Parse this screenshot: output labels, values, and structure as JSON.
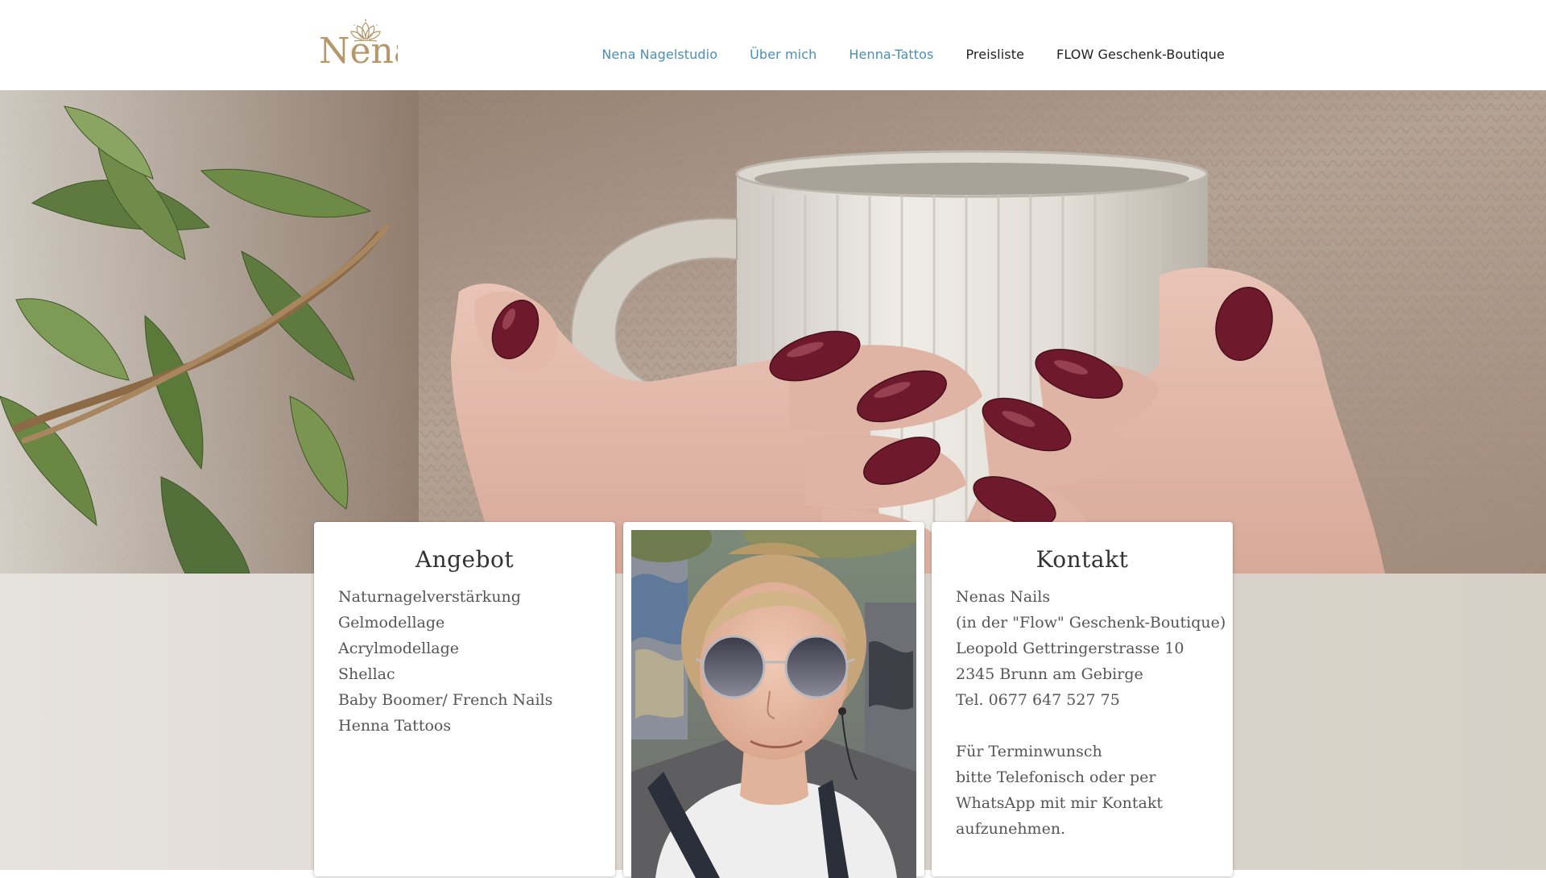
{
  "header": {
    "logo_text": "Nena",
    "nav": [
      {
        "label": "Nena Nagelstudio",
        "color": "#4b8fb5"
      },
      {
        "label": "Über mich",
        "color": "#4b8fb5"
      },
      {
        "label": "Henna-Tattos",
        "color": "#4b8fb5"
      },
      {
        "label": "Preisliste",
        "color": "#222222"
      },
      {
        "label": "FLOW Geschenk-Boutique",
        "color": "#222222"
      }
    ]
  },
  "hero": {
    "image": "hands-holding-mug-with-burgundy-nails-icon"
  },
  "cards": {
    "angebot": {
      "title": "Angebot",
      "items": [
        "Naturnagelverstärkung",
        "Gelmodellage",
        "Acrylmodellage",
        "Shellac",
        "Baby Boomer/ French Nails",
        "Henna Tattoos"
      ]
    },
    "photo": {
      "image": "portrait-photo-icon"
    },
    "kontakt": {
      "title": "Kontakt",
      "address": [
        "Nenas Nails",
        "(in der \"Flow\" Geschenk-Boutique)",
        "Leopold Gettringerstrasse 10",
        "2345 Brunn am Gebirge",
        "Tel. 0677 647 527 75"
      ],
      "note": [
        "Für Terminwunsch",
        "bitte Telefonisch oder per",
        "WhatsApp mit mir Kontakt",
        "aufzunehmen."
      ]
    }
  },
  "colors": {
    "logo_gold": "#b5976a",
    "nav_blue": "#4b8fb5",
    "nail_burgundy": "#6e1a2c",
    "band_beige": "#ddd7d0"
  }
}
